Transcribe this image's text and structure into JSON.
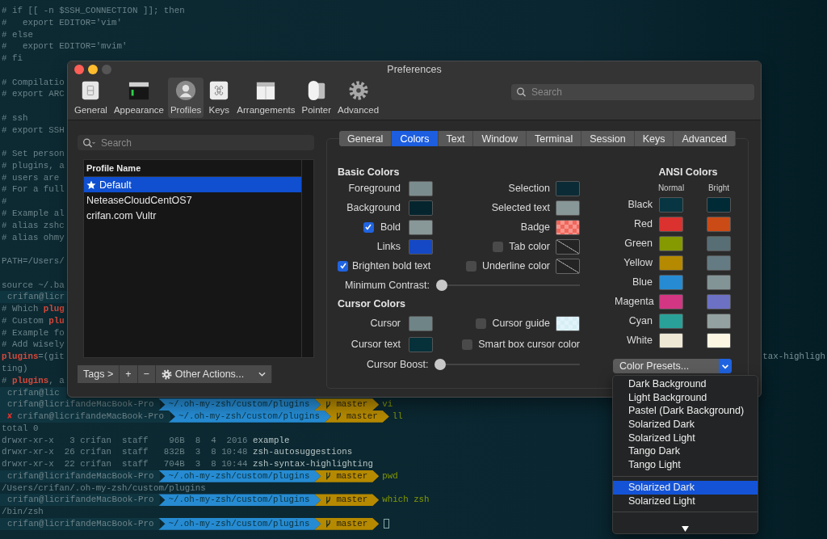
{
  "terminal": {
    "lines": [
      {
        "kind": "text",
        "parts": [
          {
            "text": "# if [[ -n $SSH_CONNECTION ]]; then",
            "kind": "plain"
          }
        ]
      },
      {
        "kind": "text",
        "parts": [
          {
            "text": "#   export EDITOR='vim'",
            "kind": "plain"
          }
        ]
      },
      {
        "kind": "text",
        "parts": [
          {
            "text": "# else",
            "kind": "plain"
          }
        ]
      },
      {
        "kind": "text",
        "parts": [
          {
            "text": "#   export EDITOR='mvim'",
            "kind": "plain"
          }
        ]
      },
      {
        "kind": "text",
        "parts": [
          {
            "text": "# fi",
            "kind": "plain"
          }
        ]
      },
      {
        "kind": "blank"
      },
      {
        "kind": "text",
        "parts": [
          {
            "text": "# Compilatio",
            "kind": "plain"
          }
        ]
      },
      {
        "kind": "text",
        "parts": [
          {
            "text": "# export ARC",
            "kind": "plain"
          }
        ]
      },
      {
        "kind": "blank"
      },
      {
        "kind": "text",
        "parts": [
          {
            "text": "# ssh",
            "kind": "plain"
          }
        ]
      },
      {
        "kind": "text",
        "parts": [
          {
            "text": "# export SSH",
            "kind": "plain"
          }
        ]
      },
      {
        "kind": "blank"
      },
      {
        "kind": "text",
        "parts": [
          {
            "text": "# Set person",
            "kind": "plain"
          }
        ]
      },
      {
        "kind": "text",
        "parts": [
          {
            "text": "# plugins, a",
            "kind": "plain"
          }
        ]
      },
      {
        "kind": "text",
        "parts": [
          {
            "text": "# users are",
            "kind": "plain"
          }
        ]
      },
      {
        "kind": "text",
        "parts": [
          {
            "text": "# For a full",
            "kind": "plain"
          }
        ]
      },
      {
        "kind": "text",
        "parts": [
          {
            "text": "#",
            "kind": "plain"
          }
        ]
      },
      {
        "kind": "text",
        "parts": [
          {
            "text": "# Example al",
            "kind": "plain"
          }
        ]
      },
      {
        "kind": "text",
        "parts": [
          {
            "text": "# alias zshc",
            "kind": "plain"
          }
        ]
      },
      {
        "kind": "text",
        "parts": [
          {
            "text": "# alias ohmy",
            "kind": "plain"
          }
        ]
      },
      {
        "kind": "blank"
      },
      {
        "kind": "text",
        "parts": [
          {
            "text": "PATH=/Users/",
            "kind": "plain"
          }
        ]
      },
      {
        "kind": "blank"
      },
      {
        "kind": "text",
        "parts": [
          {
            "text": "source ~/.ba",
            "kind": "plain"
          }
        ]
      },
      {
        "kind": "prompt",
        "user": "crifan@licr"
      },
      {
        "kind": "text",
        "parts": [
          {
            "text": "# Which ",
            "kind": "plain"
          },
          {
            "text": "plug",
            "kind": "keyword"
          }
        ]
      },
      {
        "kind": "text",
        "parts": [
          {
            "text": "# Custom ",
            "kind": "plain"
          },
          {
            "text": "plu",
            "kind": "keyword"
          }
        ]
      },
      {
        "kind": "text",
        "parts": [
          {
            "text": "# Example fo",
            "kind": "plain"
          }
        ]
      },
      {
        "kind": "text",
        "parts": [
          {
            "text": "# Add wisely",
            "kind": "plain"
          }
        ]
      },
      {
        "kind": "text",
        "parts": [
          {
            "text": "plugins",
            "kind": "keyword"
          },
          {
            "text": "=(git",
            "kind": "plain"
          }
        ],
        "right": "tax-highligh"
      },
      {
        "kind": "text",
        "parts": [
          {
            "text": "ting)",
            "kind": "plain"
          }
        ]
      },
      {
        "kind": "text",
        "parts": [
          {
            "text": "# ",
            "kind": "plain"
          },
          {
            "text": "plugins",
            "kind": "keyword"
          },
          {
            "text": ", a",
            "kind": "plain"
          }
        ]
      },
      {
        "kind": "prompt",
        "user": "crifan@lic"
      },
      {
        "kind": "prompt",
        "user": "crifan@licrifandeMacBook-Pro",
        "path": "~/.oh-my-zsh/custom/plugins",
        "branch": "master",
        "command": "vi"
      },
      {
        "kind": "prompt",
        "status": "✘",
        "user": "crifan@licrifandeMacBook-Pro",
        "path": "~/.oh-my-zsh/custom/plugins",
        "branch": "master",
        "command": "ll"
      },
      {
        "kind": "text",
        "parts": [
          {
            "text": "total 0",
            "kind": "plain"
          }
        ]
      },
      {
        "kind": "text",
        "parts": [
          {
            "text": "drwxr-xr-x   3 crifan  staff    96B  8  4  2016 ",
            "kind": "plain"
          },
          {
            "text": "example",
            "kind": "name"
          }
        ]
      },
      {
        "kind": "text",
        "parts": [
          {
            "text": "drwxr-xr-x  26 crifan  staff   832B  3  8 10:48 ",
            "kind": "plain"
          },
          {
            "text": "zsh-autosuggestions",
            "kind": "name"
          }
        ]
      },
      {
        "kind": "text",
        "parts": [
          {
            "text": "drwxr-xr-x  22 crifan  staff   704B  3  8 10:44 ",
            "kind": "plain"
          },
          {
            "text": "zsh-syntax-highlighting",
            "kind": "name"
          }
        ]
      },
      {
        "kind": "prompt",
        "user": "crifan@licrifandeMacBook-Pro",
        "path": "~/.oh-my-zsh/custom/plugins",
        "branch": "master",
        "command": "pwd"
      },
      {
        "kind": "text",
        "parts": [
          {
            "text": "/Users/crifan/.oh-my-zsh/custom/plugins",
            "kind": "plain"
          }
        ]
      },
      {
        "kind": "prompt",
        "user": "crifan@licrifandeMacBook-Pro",
        "path": "~/.oh-my-zsh/custom/plugins",
        "branch": "master",
        "command": "which zsh"
      },
      {
        "kind": "text",
        "parts": [
          {
            "text": "/bin/zsh",
            "kind": "plain"
          }
        ]
      },
      {
        "kind": "prompt",
        "user": "crifan@licrifandeMacBook-Pro",
        "path": "~/.oh-my-zsh/custom/plugins",
        "branch": "master",
        "cursor": true
      }
    ]
  },
  "preferences": {
    "title": "Preferences",
    "toolbar": [
      {
        "label": "General",
        "selected": false
      },
      {
        "label": "Appearance",
        "selected": false
      },
      {
        "label": "Profiles",
        "selected": true
      },
      {
        "label": "Keys",
        "selected": false
      },
      {
        "label": "Arrangements",
        "selected": false
      },
      {
        "label": "Pointer",
        "selected": false
      },
      {
        "label": "Advanced",
        "selected": false
      }
    ],
    "search": {
      "placeholder": "Search"
    },
    "profiles": {
      "search": {
        "placeholder": "Search"
      },
      "column": "Profile Name",
      "rows": [
        {
          "name": "Default",
          "default": true,
          "selected": true
        },
        {
          "name": "NeteaseCloudCentOS7",
          "default": false,
          "selected": false
        },
        {
          "name": "crifan.com Vultr",
          "default": false,
          "selected": false
        }
      ],
      "actions": [
        {
          "kind": "button",
          "label": "Tags >"
        },
        {
          "kind": "button",
          "label": "+"
        },
        {
          "kind": "button",
          "label": "−"
        },
        {
          "kind": "menu",
          "label": "Other Actions..."
        }
      ]
    },
    "tabs": [
      {
        "label": "General",
        "selected": false
      },
      {
        "label": "Colors",
        "selected": true
      },
      {
        "label": "Text",
        "selected": false
      },
      {
        "label": "Window",
        "selected": false
      },
      {
        "label": "Terminal",
        "selected": false
      },
      {
        "label": "Session",
        "selected": false
      },
      {
        "label": "Keys",
        "selected": false
      },
      {
        "label": "Advanced",
        "selected": false
      }
    ],
    "basic_colors": {
      "title": "Basic Colors",
      "rows": [
        [
          {
            "kind": "swatch",
            "label": "Foreground",
            "well": {
              "kind": "solid",
              "color": "#7b8c8e"
            }
          },
          {
            "kind": "swatch",
            "label": "Selection",
            "well": {
              "kind": "solid",
              "color": "#0b2c36"
            }
          }
        ],
        [
          {
            "kind": "swatch",
            "label": "Background",
            "well": {
              "kind": "solid",
              "color": "#05252e"
            }
          },
          {
            "kind": "swatch",
            "label": "Selected text",
            "well": {
              "kind": "solid",
              "color": "#889797"
            }
          }
        ],
        [
          {
            "kind": "check-swatch",
            "label": "Bold",
            "checked": true,
            "well": {
              "kind": "solid",
              "color": "#889797"
            }
          },
          {
            "kind": "swatch",
            "label": "Badge",
            "well": {
              "kind": "checker",
              "color": "#f0675b"
            }
          }
        ],
        [
          {
            "kind": "swatch",
            "label": "Links",
            "well": {
              "kind": "solid",
              "color": "#1548c4"
            }
          },
          {
            "kind": "check-swatch",
            "label": "Tab color",
            "checked": false,
            "well": {
              "kind": "empty"
            }
          }
        ],
        [
          {
            "kind": "check",
            "label": "Brighten bold text",
            "checked": true
          },
          {
            "kind": "check-swatch",
            "label": "Underline color",
            "checked": false,
            "well": {
              "kind": "empty"
            }
          }
        ]
      ],
      "slider": {
        "label": "Minimum Contrast:",
        "level": 0
      }
    },
    "cursor_colors": {
      "title": "Cursor Colors",
      "rows": [
        [
          {
            "kind": "swatch",
            "label": "Cursor",
            "well": {
              "kind": "solid",
              "color": "#6f8486"
            }
          },
          {
            "kind": "check-swatch",
            "label": "Cursor guide",
            "checked": false,
            "well": {
              "kind": "checker",
              "color": "#d6eef6"
            }
          }
        ],
        [
          {
            "kind": "swatch",
            "label": "Cursor text",
            "well": {
              "kind": "solid",
              "color": "#06303a"
            }
          },
          {
            "kind": "check",
            "label": "Smart box cursor color",
            "checked": false
          }
        ]
      ],
      "slider": {
        "label": "Cursor Boost:",
        "level": 0
      }
    },
    "ansi_colors": {
      "title": "ANSI Colors",
      "normal": "Normal",
      "bright": "Bright",
      "rows": [
        {
          "name": "Black",
          "wells": [
            {
              "color": "#073642"
            },
            {
              "color": "#002b36"
            }
          ]
        },
        {
          "name": "Red",
          "wells": [
            {
              "color": "#dc322f"
            },
            {
              "color": "#cb4b16"
            }
          ]
        },
        {
          "name": "Green",
          "wells": [
            {
              "color": "#859900"
            },
            {
              "color": "#586e75"
            }
          ]
        },
        {
          "name": "Yellow",
          "wells": [
            {
              "color": "#b58900"
            },
            {
              "color": "#657b83"
            }
          ]
        },
        {
          "name": "Blue",
          "wells": [
            {
              "color": "#268bd2"
            },
            {
              "color": "#839496"
            }
          ]
        },
        {
          "name": "Magenta",
          "wells": [
            {
              "color": "#d33682"
            },
            {
              "color": "#6c71c4"
            }
          ]
        },
        {
          "name": "Cyan",
          "wells": [
            {
              "color": "#2aa198"
            },
            {
              "color": "#93a1a1"
            }
          ]
        },
        {
          "name": "White",
          "wells": [
            {
              "color": "#eee8d5"
            },
            {
              "color": "#fdf6e3"
            }
          ]
        }
      ]
    },
    "color_presets": {
      "label": "Color Presets...",
      "menu": {
        "more_below": true,
        "items": [
          {
            "kind": "item",
            "label": "Dark Background",
            "selected": false
          },
          {
            "kind": "item",
            "label": "Light Background",
            "selected": false
          },
          {
            "kind": "item",
            "label": "Pastel (Dark Background)",
            "selected": false
          },
          {
            "kind": "item",
            "label": "Solarized Dark",
            "selected": false
          },
          {
            "kind": "item",
            "label": "Solarized Light",
            "selected": false
          },
          {
            "kind": "item",
            "label": "Tango Dark",
            "selected": false
          },
          {
            "kind": "item",
            "label": "Tango Light",
            "selected": false
          },
          {
            "kind": "separator"
          },
          {
            "kind": "item",
            "label": "Solarized Dark",
            "selected": true
          },
          {
            "kind": "item",
            "label": "Solarized Light",
            "selected": false
          },
          {
            "kind": "separator"
          }
        ]
      }
    }
  }
}
